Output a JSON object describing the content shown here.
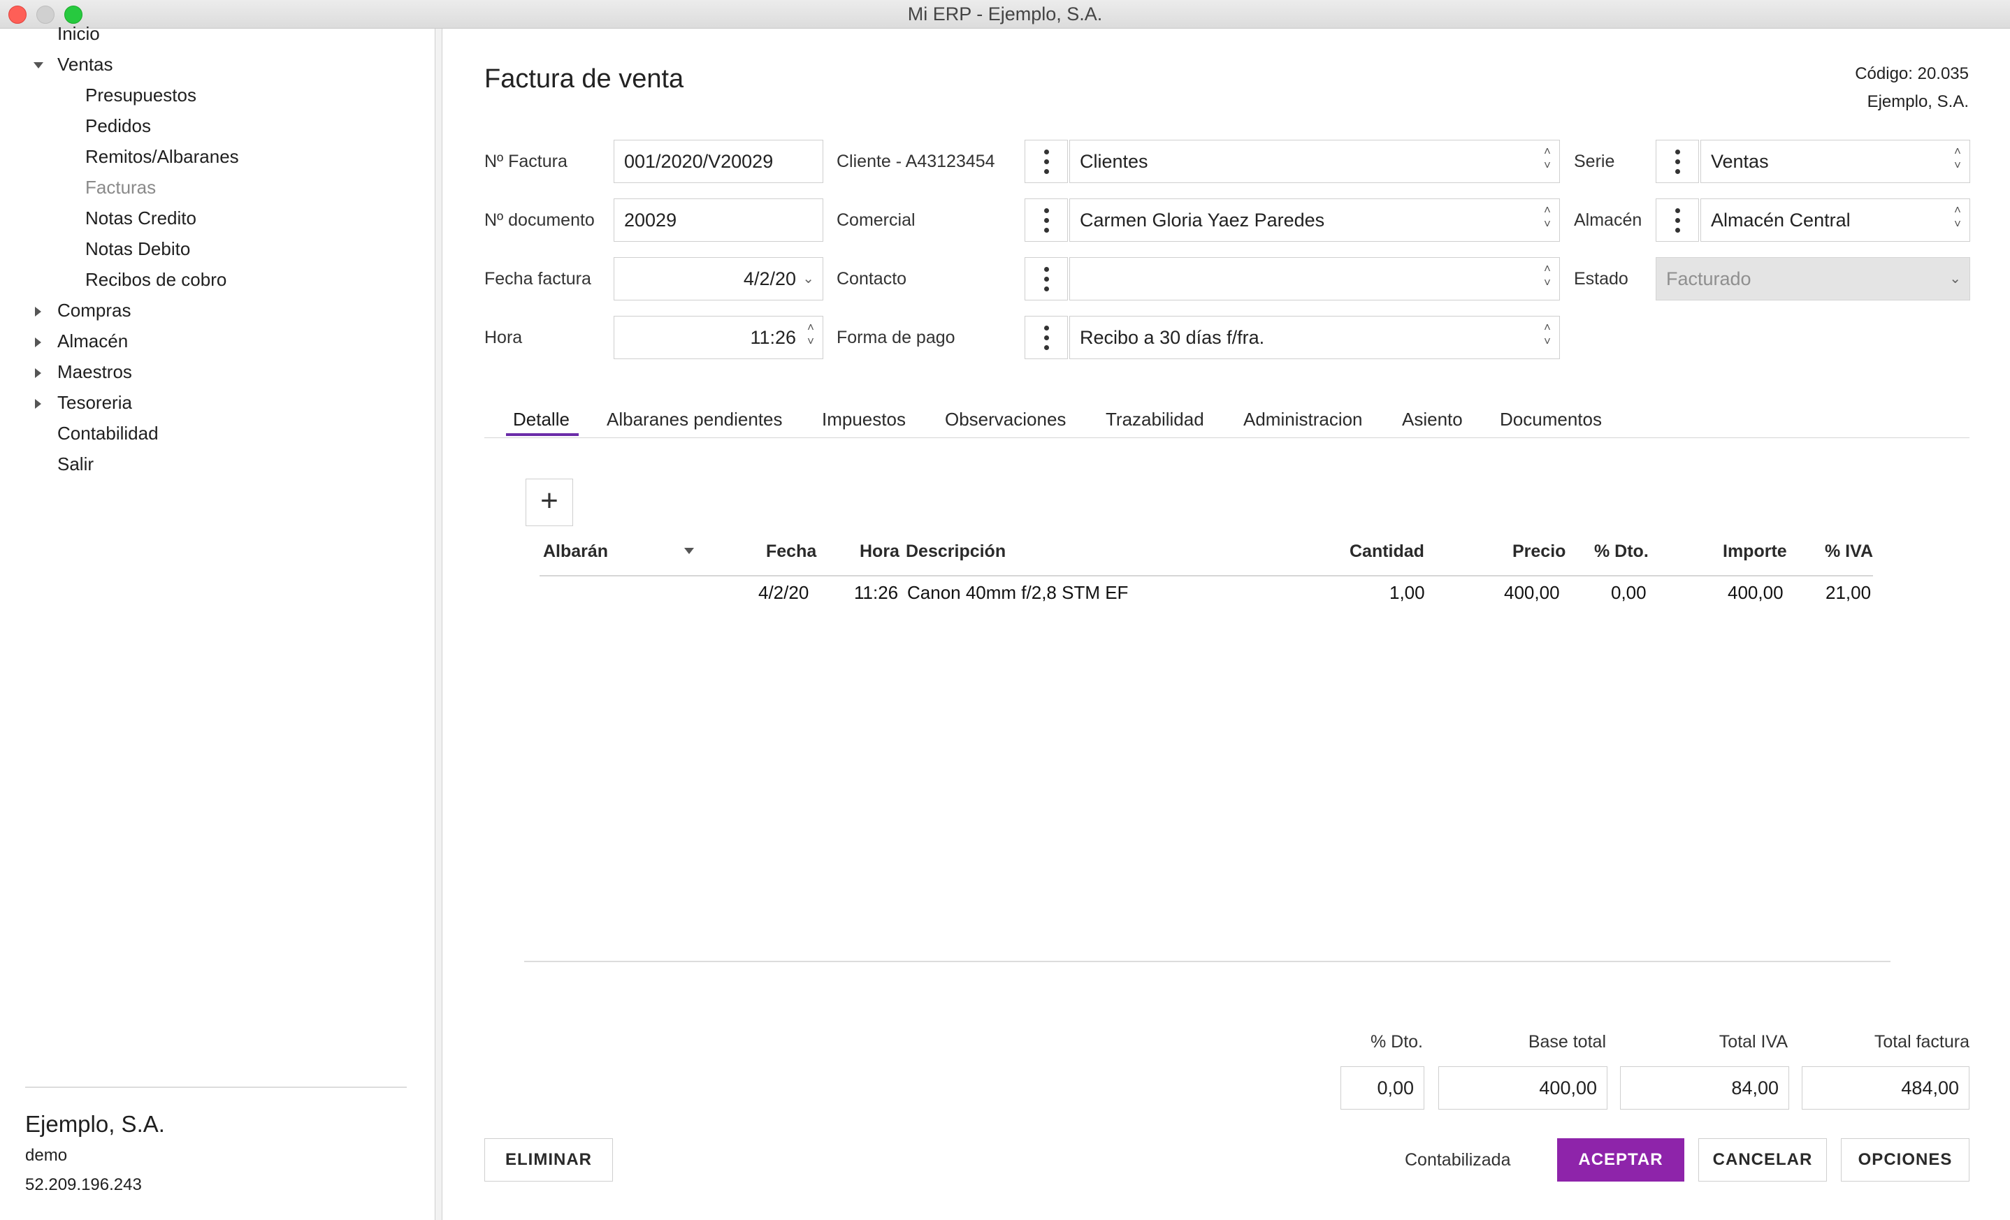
{
  "window": {
    "title": "Mi ERP - Ejemplo, S.A."
  },
  "sidebar": {
    "items": [
      {
        "label": "Inicio"
      },
      {
        "label": "Ventas"
      },
      {
        "label": "Presupuestos"
      },
      {
        "label": "Pedidos"
      },
      {
        "label": "Remitos/Albaranes"
      },
      {
        "label": "Facturas"
      },
      {
        "label": "Notas Credito"
      },
      {
        "label": "Notas Debito"
      },
      {
        "label": "Recibos de cobro"
      },
      {
        "label": "Compras"
      },
      {
        "label": "Almacén"
      },
      {
        "label": "Maestros"
      },
      {
        "label": "Tesoreria"
      },
      {
        "label": "Contabilidad"
      },
      {
        "label": "Salir"
      }
    ],
    "footer": {
      "company": "Ejemplo, S.A.",
      "user": "demo",
      "ip": "52.209.196.243"
    }
  },
  "header": {
    "title": "Factura de venta",
    "code": "Código: 20.035",
    "company": "Ejemplo, S.A."
  },
  "form": {
    "invoice_no": {
      "label": "Nº Factura",
      "value": "001/2020/V20029"
    },
    "doc_no": {
      "label": "Nº documento",
      "value": "20029"
    },
    "invoice_date": {
      "label": "Fecha factura",
      "value": "4/2/20"
    },
    "time": {
      "label": "Hora",
      "value": "11:26"
    },
    "client": {
      "label": "Cliente  -  A43123454",
      "value": "Clientes"
    },
    "sales_rep": {
      "label": "Comercial",
      "value": "Carmen Gloria Yaez Paredes"
    },
    "contact": {
      "label": "Contacto",
      "value": ""
    },
    "payment": {
      "label": "Forma de pago",
      "value": "Recibo a 30 días f/fra."
    },
    "series": {
      "label": "Serie",
      "value": "Ventas"
    },
    "warehouse": {
      "label": "Almacén",
      "value": "Almacén Central"
    },
    "status": {
      "label": "Estado",
      "value": "Facturado"
    }
  },
  "tabs": [
    {
      "label": "Detalle"
    },
    {
      "label": "Albaranes pendientes"
    },
    {
      "label": "Impuestos"
    },
    {
      "label": "Observaciones"
    },
    {
      "label": "Trazabilidad"
    },
    {
      "label": "Administracion"
    },
    {
      "label": "Asiento"
    },
    {
      "label": "Documentos"
    }
  ],
  "table": {
    "add_label": "+",
    "columns": [
      "Albarán",
      "Fecha",
      "Hora",
      "Descripción",
      "Cantidad",
      "Precio",
      "% Dto.",
      "Importe",
      "% IVA"
    ],
    "rows": [
      {
        "albaran": "",
        "fecha": "4/2/20",
        "hora": "11:26",
        "descripcion": "Canon 40mm f/2,8 STM EF",
        "cantidad": "1,00",
        "precio": "400,00",
        "dto": "0,00",
        "importe": "400,00",
        "iva": "21,00"
      }
    ]
  },
  "totals": {
    "discount": {
      "label": "% Dto.",
      "value": "0,00"
    },
    "base": {
      "label": "Base total",
      "value": "400,00"
    },
    "vat": {
      "label": "Total IVA",
      "value": "84,00"
    },
    "total": {
      "label": "Total factura",
      "value": "484,00"
    }
  },
  "actions": {
    "delete": "ELIMINAR",
    "status": "Contabilizada",
    "accept": "ACEPTAR",
    "cancel": "CANCELAR",
    "options": "OPCIONES"
  },
  "colors": {
    "accent": "#8e24aa",
    "tab_underline": "#6b2da8"
  }
}
